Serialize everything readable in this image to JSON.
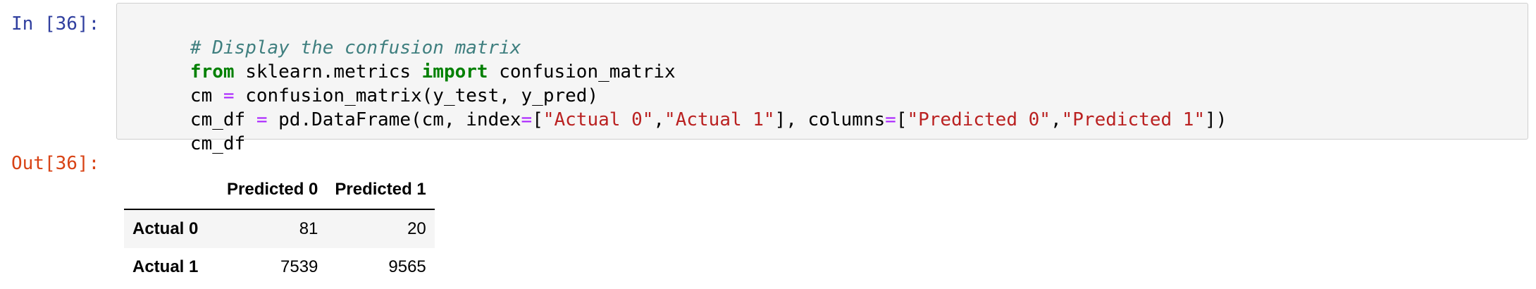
{
  "input_cell": {
    "prompt": "In [36]:",
    "lines": [
      [
        {
          "text": "# Display the confusion matrix",
          "kind": "comment"
        }
      ],
      [
        {
          "text": "from",
          "kind": "kw"
        },
        {
          "text": " sklearn.metrics ",
          "kind": "plain"
        },
        {
          "text": "import",
          "kind": "kw"
        },
        {
          "text": " confusion_matrix",
          "kind": "plain"
        }
      ],
      [
        {
          "text": "cm ",
          "kind": "plain"
        },
        {
          "text": "=",
          "kind": "op"
        },
        {
          "text": " confusion_matrix(y_test, y_pred)",
          "kind": "plain"
        }
      ],
      [
        {
          "text": "cm_df ",
          "kind": "plain"
        },
        {
          "text": "=",
          "kind": "op"
        },
        {
          "text": " pd.DataFrame(cm, index",
          "kind": "plain"
        },
        {
          "text": "=",
          "kind": "op"
        },
        {
          "text": "[",
          "kind": "plain"
        },
        {
          "text": "\"Actual 0\"",
          "kind": "str"
        },
        {
          "text": ",",
          "kind": "plain"
        },
        {
          "text": "\"Actual 1\"",
          "kind": "str"
        },
        {
          "text": "], columns",
          "kind": "plain"
        },
        {
          "text": "=",
          "kind": "op"
        },
        {
          "text": "[",
          "kind": "plain"
        },
        {
          "text": "\"Predicted 0\"",
          "kind": "str"
        },
        {
          "text": ",",
          "kind": "plain"
        },
        {
          "text": "\"Predicted 1\"",
          "kind": "str"
        },
        {
          "text": "])",
          "kind": "plain"
        }
      ],
      [
        {
          "text": "cm_df",
          "kind": "plain"
        }
      ]
    ]
  },
  "output_cell": {
    "prompt": "Out[36]:",
    "table": {
      "corner": "",
      "columns": [
        "Predicted 0",
        "Predicted 1"
      ],
      "rows": [
        {
          "label": "Actual 0",
          "values": [
            "81",
            "20"
          ]
        },
        {
          "label": "Actual 1",
          "values": [
            "7539",
            "9565"
          ]
        }
      ]
    }
  },
  "colors": {
    "in_prompt": "#303f9f",
    "out_prompt": "#d84315",
    "comment": "#3f7f7f",
    "keyword": "#008000",
    "operator": "#aa22ff",
    "string": "#ba2121",
    "code_background": "#f5f5f5"
  }
}
